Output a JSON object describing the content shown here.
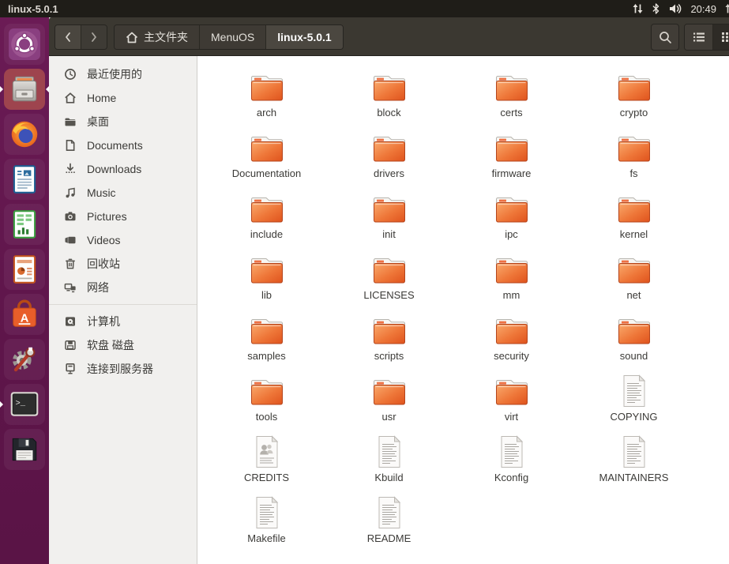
{
  "topbar": {
    "title": "linux-5.0.1",
    "time": "20:49",
    "status_icons": [
      "network-traffic-icon",
      "bluetooth-icon",
      "volume-icon"
    ]
  },
  "toolbar": {
    "breadcrumbs": [
      {
        "key": "home-folder",
        "label": "主文件夹",
        "icon": "home",
        "active": false
      },
      {
        "key": "menuos",
        "label": "MenuOS",
        "active": false
      },
      {
        "key": "linux-5.0.1",
        "label": "linux-5.0.1",
        "active": true
      }
    ]
  },
  "dock": {
    "items": [
      {
        "name": "ubuntu-launcher",
        "icon": "ubuntu-logo",
        "running": false,
        "focused": false
      },
      {
        "name": "files-app",
        "icon": "files",
        "running": true,
        "focused": true
      },
      {
        "name": "firefox",
        "icon": "firefox",
        "running": false,
        "focused": false
      },
      {
        "name": "libreoffice-writer",
        "icon": "writer",
        "running": false,
        "focused": false
      },
      {
        "name": "libreoffice-calc",
        "icon": "calc",
        "running": false,
        "focused": false
      },
      {
        "name": "libreoffice-impress",
        "icon": "impress",
        "running": false,
        "focused": false
      },
      {
        "name": "ubuntu-software",
        "icon": "software",
        "running": false,
        "focused": false
      },
      {
        "name": "system-settings",
        "icon": "settings",
        "running": false,
        "focused": false
      },
      {
        "name": "terminal",
        "icon": "terminal",
        "running": true,
        "focused": false
      },
      {
        "name": "floppy-volume",
        "icon": "floppy-disk",
        "running": false,
        "focused": false
      }
    ]
  },
  "sidebar": {
    "sections": [
      {
        "items": [
          {
            "key": "recent",
            "label": "最近使用的",
            "icon": "clock"
          },
          {
            "key": "home",
            "label": "Home",
            "icon": "home"
          },
          {
            "key": "desktop",
            "label": "桌面",
            "icon": "folder"
          },
          {
            "key": "documents",
            "label": "Documents",
            "icon": "document"
          },
          {
            "key": "downloads",
            "label": "Downloads",
            "icon": "download"
          },
          {
            "key": "music",
            "label": "Music",
            "icon": "music"
          },
          {
            "key": "pictures",
            "label": "Pictures",
            "icon": "camera"
          },
          {
            "key": "videos",
            "label": "Videos",
            "icon": "video"
          },
          {
            "key": "trash",
            "label": "回收站",
            "icon": "trash"
          },
          {
            "key": "network",
            "label": "网络",
            "icon": "network"
          }
        ]
      },
      {
        "items": [
          {
            "key": "computer",
            "label": "计算机",
            "icon": "computer"
          },
          {
            "key": "floppy-disk",
            "label": "软盘 磁盘",
            "icon": "floppy"
          },
          {
            "key": "connect-server",
            "label": "连接到服务器",
            "icon": "server"
          }
        ]
      }
    ]
  },
  "files": [
    {
      "name": "arch",
      "type": "folder"
    },
    {
      "name": "block",
      "type": "folder"
    },
    {
      "name": "certs",
      "type": "folder"
    },
    {
      "name": "crypto",
      "type": "folder"
    },
    {
      "name": "Documentation",
      "type": "folder"
    },
    {
      "name": "drivers",
      "type": "folder"
    },
    {
      "name": "firmware",
      "type": "folder"
    },
    {
      "name": "fs",
      "type": "folder"
    },
    {
      "name": "include",
      "type": "folder"
    },
    {
      "name": "init",
      "type": "folder"
    },
    {
      "name": "ipc",
      "type": "folder"
    },
    {
      "name": "kernel",
      "type": "folder"
    },
    {
      "name": "lib",
      "type": "folder"
    },
    {
      "name": "LICENSES",
      "type": "folder"
    },
    {
      "name": "mm",
      "type": "folder"
    },
    {
      "name": "net",
      "type": "folder"
    },
    {
      "name": "samples",
      "type": "folder"
    },
    {
      "name": "scripts",
      "type": "folder"
    },
    {
      "name": "security",
      "type": "folder"
    },
    {
      "name": "sound",
      "type": "folder"
    },
    {
      "name": "tools",
      "type": "folder"
    },
    {
      "name": "usr",
      "type": "folder"
    },
    {
      "name": "virt",
      "type": "folder"
    },
    {
      "name": "COPYING",
      "type": "text"
    },
    {
      "name": "CREDITS",
      "type": "credits"
    },
    {
      "name": "Kbuild",
      "type": "text"
    },
    {
      "name": "Kconfig",
      "type": "text"
    },
    {
      "name": "MAINTAINERS",
      "type": "text"
    },
    {
      "name": "Makefile",
      "type": "text"
    },
    {
      "name": "README",
      "type": "text"
    }
  ],
  "colors": {
    "topbar_bg": "#1F1D18",
    "headerbar_bg": "#3B3831",
    "dock_purple": "#65194F",
    "sidebar_bg": "#F1F0EE",
    "folder_orange": "#E8632F",
    "accent_orange": "#E95420",
    "file_label": "#3B3A37"
  }
}
